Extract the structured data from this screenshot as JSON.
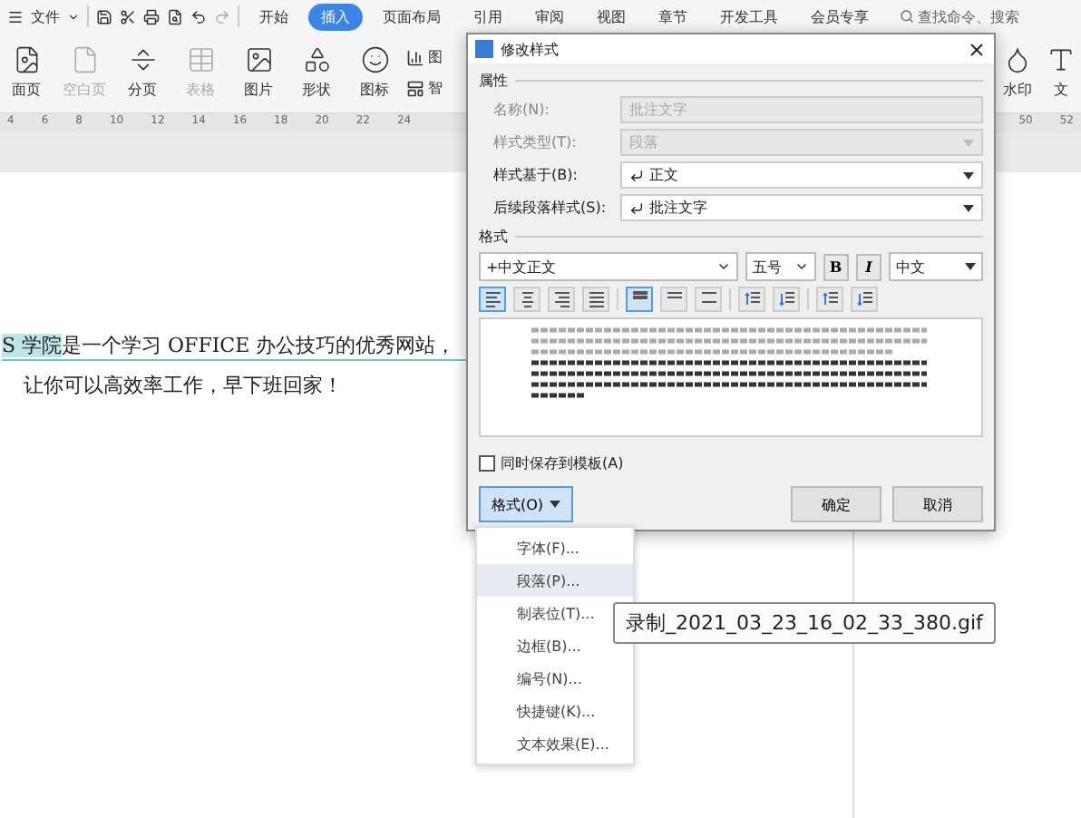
{
  "menu_bar": {
    "file_label": "文件",
    "tabs": [
      {
        "label": "开始",
        "selected": false
      },
      {
        "label": "插入",
        "selected": true
      },
      {
        "label": "页面布局",
        "selected": false
      },
      {
        "label": "引用",
        "selected": false
      },
      {
        "label": "审阅",
        "selected": false
      },
      {
        "label": "视图",
        "selected": false
      },
      {
        "label": "章节",
        "selected": false
      },
      {
        "label": "开发工具",
        "selected": false
      },
      {
        "label": "会员专享",
        "selected": false
      }
    ],
    "search_placeholder": "查找命令、搜索"
  },
  "ribbon": {
    "items": [
      {
        "kind": "cover",
        "label": "面页",
        "disabled": false
      },
      {
        "kind": "blank",
        "label": "空白页",
        "disabled": true
      },
      {
        "kind": "break",
        "label": "分页",
        "disabled": false
      },
      {
        "kind": "table",
        "label": "表格",
        "disabled": true
      },
      {
        "kind": "picture",
        "label": "图片",
        "disabled": false
      },
      {
        "kind": "shape",
        "label": "形状",
        "disabled": false
      },
      {
        "kind": "icons",
        "label": "图标",
        "disabled": false
      }
    ],
    "small_items": [
      {
        "kind": "chart",
        "label": "图"
      },
      {
        "kind": "smart",
        "label": "智"
      }
    ],
    "right_items": [
      {
        "kind": "watermark",
        "label": "水印"
      },
      {
        "kind": "text",
        "label": "文"
      }
    ]
  },
  "ruler": {
    "left_ticks": [
      "4",
      "6",
      "8",
      "10",
      "12",
      "14",
      "16",
      "18",
      "20",
      "22",
      "24"
    ],
    "right_ticks": [
      "50",
      "52"
    ]
  },
  "document": {
    "line_1": {
      "highlighted": "S 学院",
      "rest": "是一个学习 OFFICE 办公技巧的优秀网站，"
    },
    "line_2": "让你可以高效率工作，早下班回家！"
  },
  "dialog": {
    "title": "修改样式",
    "properties_heading": "属性",
    "fields": [
      {
        "kind": "text",
        "label": "名称(N):",
        "value": "批注文字",
        "disabled": true
      },
      {
        "kind": "select",
        "label": "样式类型(T):",
        "value": "段落",
        "disabled": true
      },
      {
        "kind": "select",
        "label": "样式基于(B):",
        "value": "正文",
        "disabled": false
      },
      {
        "kind": "select",
        "label": "后续段落样式(S):",
        "value": "批注文字",
        "disabled": false
      }
    ],
    "format_heading": "格式",
    "font": "+中文正文",
    "size": "五号",
    "bold": "B",
    "italic": "I",
    "language": "中文",
    "tools": [
      {
        "kind": "align-left",
        "selected": true
      },
      {
        "kind": "align-center",
        "selected": false
      },
      {
        "kind": "align-right",
        "selected": false
      },
      {
        "kind": "justify",
        "selected": false
      },
      {
        "kind": "line-single",
        "selected": true
      },
      {
        "kind": "line-half",
        "selected": false
      },
      {
        "kind": "line-double",
        "selected": false
      },
      {
        "kind": "space-up",
        "selected": false
      },
      {
        "kind": "space-down",
        "selected": false
      },
      {
        "kind": "indent-less",
        "selected": false
      },
      {
        "kind": "indent-more",
        "selected": false
      }
    ],
    "save_to_template": {
      "label": "同时保存到模板(A)",
      "checked": false
    },
    "format_button": "格式(O)",
    "ok": "确定",
    "cancel": "取消"
  },
  "format_menu": [
    {
      "label": "字体(F)...",
      "selected": false
    },
    {
      "label": "段落(P)...",
      "selected": true
    },
    {
      "label": "制表位(T)...",
      "selected": false
    },
    {
      "label": "边框(B)...",
      "selected": false
    },
    {
      "label": "编号(N)...",
      "selected": false
    },
    {
      "label": "快捷键(K)...",
      "selected": false
    },
    {
      "label": "文本效果(E)...",
      "selected": false
    }
  ],
  "tooltip": "录制_2021_03_23_16_02_33_380.gif"
}
